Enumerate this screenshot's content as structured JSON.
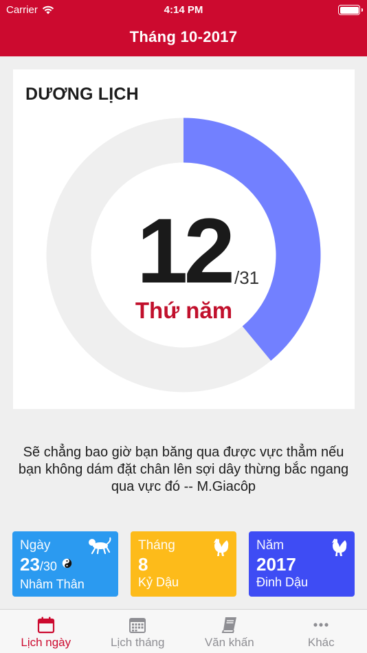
{
  "status": {
    "carrier": "Carrier",
    "time": "4:14 PM"
  },
  "header": {
    "title": "Tháng 10-2017"
  },
  "solar": {
    "title": "DƯƠNG LỊCH",
    "day": "12",
    "total": "/31",
    "weekday": "Thứ năm",
    "progress": 0.39,
    "colors": {
      "progress": "#7280ff",
      "track": "#efefef",
      "weekday": "#c1102c"
    }
  },
  "quote": "Sẽ chẳng bao giờ bạn băng qua được vực thẳm nếu bạn không dám đặt chân lên sợi dây thừng bắc ngang qua vực đó -- M.Giacôp",
  "lunar": {
    "day": {
      "label": "Ngày",
      "value": "23",
      "total": "/30",
      "name": "Nhâm Thân",
      "animal": "monkey-icon",
      "color": "#2b9af0"
    },
    "month": {
      "label": "Tháng",
      "value": "8",
      "name": "Kỷ Dậu",
      "animal": "rooster-icon",
      "color": "#fdbb1a"
    },
    "year": {
      "label": "Năm",
      "value": "2017",
      "name": "Đinh Dậu",
      "animal": "rooster-icon",
      "color": "#3e4cf4"
    }
  },
  "tabs": [
    {
      "label": "Lịch ngày",
      "icon": "calendar-day-icon",
      "active": true
    },
    {
      "label": "Lịch tháng",
      "icon": "calendar-month-icon",
      "active": false
    },
    {
      "label": "Văn khấn",
      "icon": "book-icon",
      "active": false
    },
    {
      "label": "Khác",
      "icon": "more-icon",
      "active": false
    }
  ],
  "colors": {
    "brand": "#cc0a2f"
  }
}
